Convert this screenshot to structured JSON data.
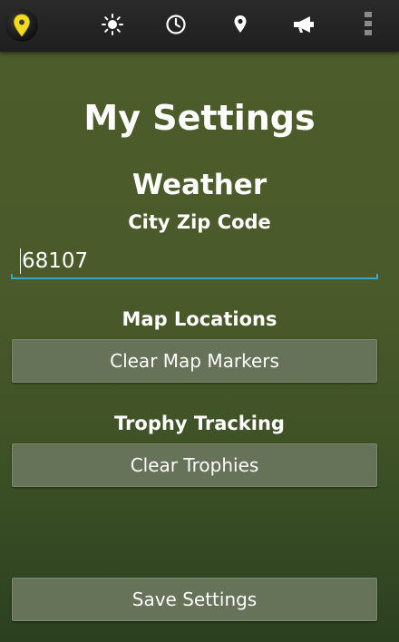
{
  "colors": {
    "background": "#4a5a2a",
    "action_bar": "#222222",
    "button": "#667358",
    "field_underline": "#3aa7c9",
    "logo_pin": "#f2dc1f"
  },
  "action_bar": {
    "icons": [
      "app-logo-map-pin-icon",
      "weather-sun-icon",
      "clock-icon",
      "location-pin-icon",
      "megaphone-icon",
      "overflow-menu-icon"
    ]
  },
  "page": {
    "title": "My Settings"
  },
  "weather": {
    "heading": "Weather",
    "zip_label": "City Zip Code",
    "zip_value": "68107"
  },
  "map": {
    "heading": "Map Locations",
    "clear_button_label": "Clear Map Markers"
  },
  "trophy": {
    "heading": "Trophy Tracking",
    "clear_button_label": "Clear Trophies"
  },
  "footer": {
    "save_button_label": "Save Settings"
  }
}
